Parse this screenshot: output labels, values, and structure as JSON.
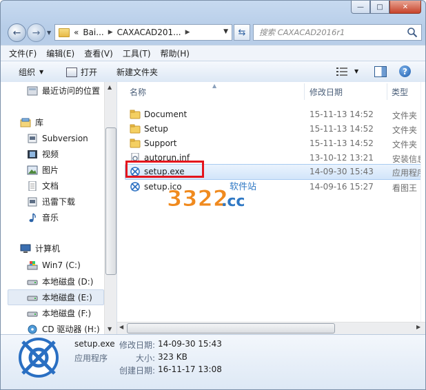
{
  "window": {
    "caption_buttons": [
      "minimize",
      "maximize",
      "close"
    ]
  },
  "address": {
    "prefix": "«",
    "crumbs": [
      "Bai...",
      "CAXACAD201..."
    ],
    "search_placeholder": "搜索 CAXACAD2016r1"
  },
  "menu": [
    "文件(F)",
    "编辑(E)",
    "查看(V)",
    "工具(T)",
    "帮助(H)"
  ],
  "commands": {
    "organize": "组织",
    "open": "打开",
    "new_folder": "新建文件夹"
  },
  "nav": {
    "recent": "最近访问的位置",
    "library": "库",
    "subversion": "Subversion",
    "videos": "视频",
    "pictures": "图片",
    "documents": "文档",
    "thunder": "迅雷下载",
    "music": "音乐",
    "computer": "计算机",
    "drive_c": "Win7 (C:)",
    "drive_d": "本地磁盘 (D:)",
    "drive_e": "本地磁盘 (E:)",
    "drive_f": "本地磁盘 (F:)",
    "drive_h": "CD 驱动器 (H:)"
  },
  "columns": {
    "name": "名称",
    "date": "修改日期",
    "type": "类型"
  },
  "files": [
    {
      "name": "Document",
      "date": "15-11-13 14:52",
      "type": "文件夹",
      "icon": "folder-icon"
    },
    {
      "name": "Setup",
      "date": "15-11-13 14:52",
      "type": "文件夹",
      "icon": "folder-icon"
    },
    {
      "name": "Support",
      "date": "15-11-13 14:52",
      "type": "文件夹",
      "icon": "folder-icon"
    },
    {
      "name": "autorun.inf",
      "date": "13-10-12 13:21",
      "type": "安装信息",
      "icon": "settings-file-icon"
    },
    {
      "name": "setup.exe",
      "date": "14-09-30 15:43",
      "type": "应用程序",
      "icon": "caxa-app-icon"
    },
    {
      "name": "setup.ico",
      "date": "14-09-16 15:27",
      "type": "看图王 I",
      "icon": "caxa-app-icon"
    }
  ],
  "watermark": {
    "number": "3322",
    "suffix": ".cc",
    "label": "软件站"
  },
  "details": {
    "filename": "setup.exe",
    "filetype": "应用程序",
    "modified_label": "修改日期:",
    "modified_value": "14-09-30 15:43",
    "size_label": "大小:",
    "size_value": "323 KB",
    "created_label": "创建日期:",
    "created_value": "16-11-17 13:08"
  },
  "colors": {
    "highlight_box": "#e4141c",
    "selection": "#d2e5fa",
    "watermark_orange": "#f08a1e",
    "watermark_blue": "#2f78c4"
  }
}
